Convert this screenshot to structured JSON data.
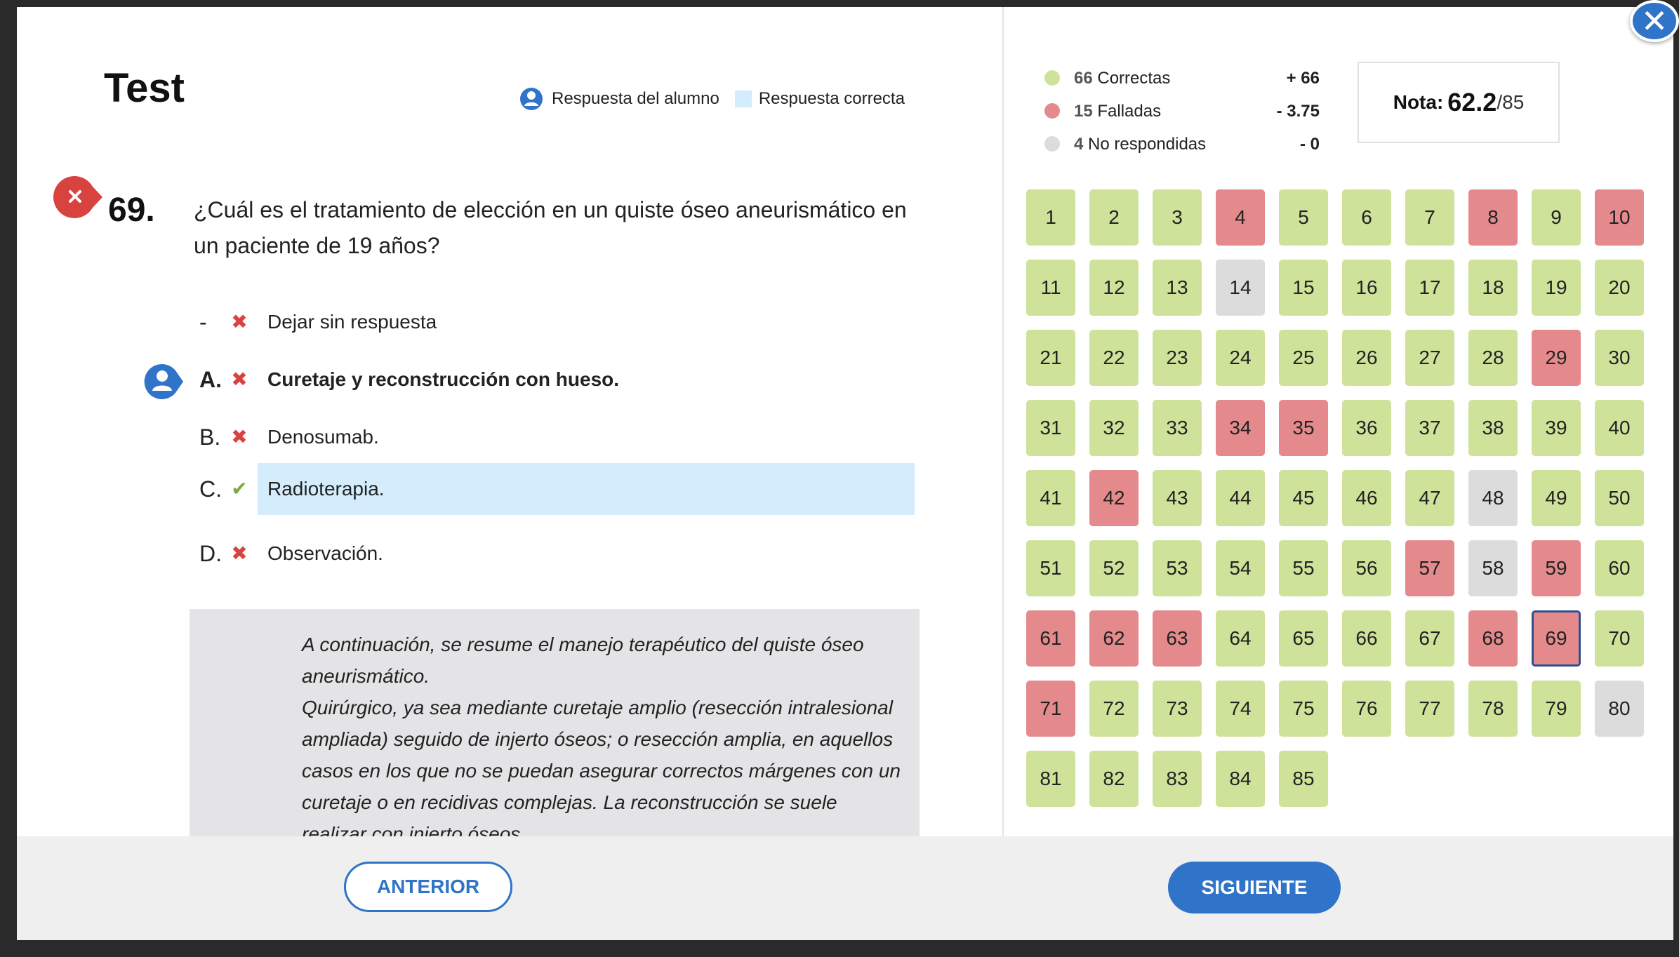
{
  "title": "Test",
  "legend": {
    "student_answer": "Respuesta del alumno",
    "correct_answer": "Respuesta correcta"
  },
  "question": {
    "number": "69.",
    "text": "¿Cuál es el tratamiento de elección en un quiste óseo aneurismático en un paciente de 19 años?",
    "status_icon": "wrong-x-icon",
    "options": [
      {
        "letter": "-",
        "mark": "✖",
        "mark_type": "wrong",
        "text": "Dejar sin respuesta",
        "selected": false,
        "correct": false
      },
      {
        "letter": "A.",
        "mark": "✖",
        "mark_type": "wrong",
        "text": "Curetaje y reconstrucción con hueso.",
        "selected": true,
        "correct": false
      },
      {
        "letter": "B.",
        "mark": "✖",
        "mark_type": "wrong",
        "text": "Denosumab.",
        "selected": false,
        "correct": false
      },
      {
        "letter": "C.",
        "mark": "✔",
        "mark_type": "right",
        "text": "Radioterapia.",
        "selected": false,
        "correct": true
      },
      {
        "letter": "D.",
        "mark": "✖",
        "mark_type": "wrong",
        "text": "Observación.",
        "selected": false,
        "correct": false
      }
    ],
    "explanation_lines": [
      "A continuación, se resume el manejo terapéutico del quiste óseo aneurismático.",
      "Quirúrgico, ya sea mediante curetaje amplio (resección intralesional ampliada) seguido de injerto óseos; o resección amplia, en aquellos casos en los que no se puedan asegurar correctos márgenes con un curetaje o en recidivas complejas. La reconstrucción se suele realizar con injerto óseos."
    ]
  },
  "summary": {
    "correct": {
      "count": "66",
      "label": "Correctas",
      "points": "+ 66"
    },
    "failed": {
      "count": "15",
      "label": "Falladas",
      "points": "- 3.75"
    },
    "unanswered": {
      "count": "4",
      "label": "No respondidas",
      "points": "- 0"
    }
  },
  "grade": {
    "label": "Nota:",
    "value": "62.2",
    "total": "/85"
  },
  "colors": {
    "accent": "#2f74c8",
    "correct": "#cfe29a",
    "wrong": "#e48a8c",
    "none": "#dcdcdc",
    "highlight": "#d4ecfb"
  },
  "footer": {
    "prev_label": "ANTERIOR",
    "next_label": "SIGUIENTE"
  },
  "current_question": 69,
  "answer_grid": {
    "wrong": [
      4,
      8,
      10,
      29,
      34,
      35,
      42,
      57,
      59,
      61,
      62,
      63,
      68,
      69,
      71
    ],
    "unanswered": [
      14,
      48,
      58,
      80
    ],
    "total": 85
  },
  "close_icon": "close-x-icon"
}
